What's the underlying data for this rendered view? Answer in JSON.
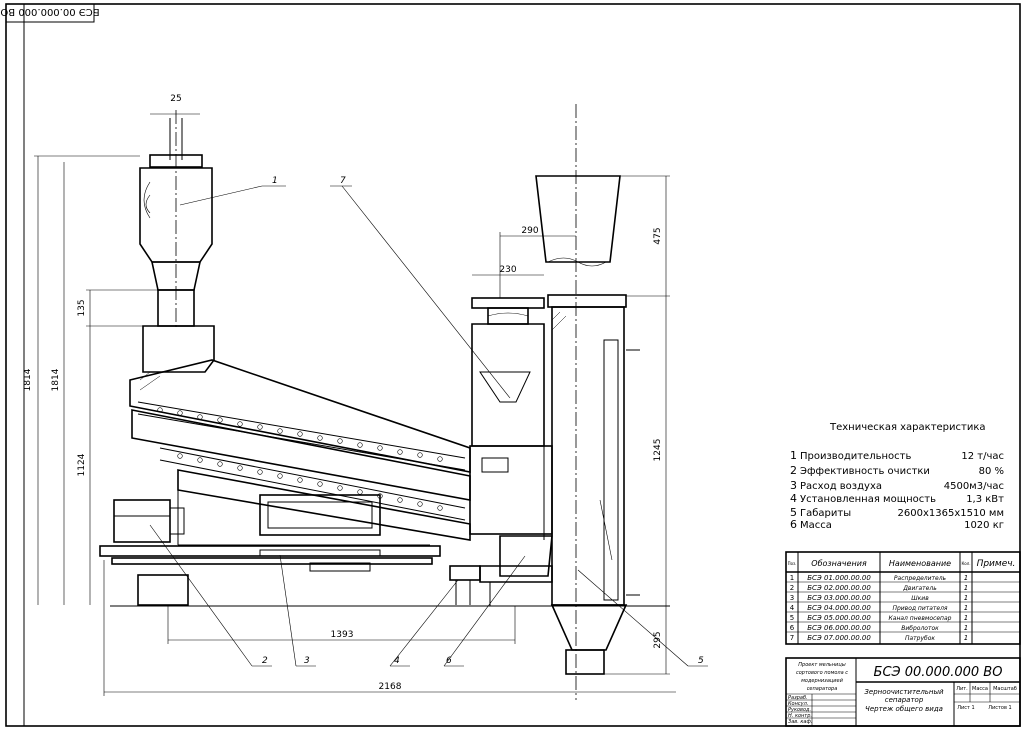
{
  "stamp_top": "БСЭ 00.000.000 ВО",
  "dimensions": {
    "d25": "25",
    "d135": "135",
    "d1814a": "1814",
    "d1814b": "1814",
    "d1124": "1124",
    "d290": "290",
    "d230": "230",
    "d475": "475",
    "d1245": "1245",
    "d295": "295",
    "d1393": "1393",
    "d2168": "2168"
  },
  "callouts": [
    "1",
    "2",
    "3",
    "4",
    "5",
    "6",
    "7"
  ],
  "specs": {
    "title": "Техническая характеристика",
    "rows": [
      {
        "n": "1",
        "label": "Производительность",
        "value": "12 т/час"
      },
      {
        "n": "2",
        "label": "Эффективность очистки",
        "value": "80 %"
      },
      {
        "n": "3",
        "label": "Расход воздуха",
        "value": "4500м3/час"
      },
      {
        "n": "4",
        "label": "Установленная мощность",
        "value": "1,3 кВт"
      },
      {
        "n": "5",
        "label": "Габариты",
        "value": "2600х1365х1510 мм"
      },
      {
        "n": "6",
        "label": "Масса",
        "value": "1020 кг"
      }
    ]
  },
  "parts_table": {
    "headers": {
      "pos": "Поз.",
      "code": "Обозначения",
      "name": "Наименование",
      "qty": "Кол.",
      "note": "Примеч."
    },
    "rows": [
      {
        "pos": "1",
        "code": "БСЭ 01.000.00.00",
        "name": "Распределитель",
        "qty": "1"
      },
      {
        "pos": "2",
        "code": "БСЭ 02.000.00.00",
        "name": "Двигатель",
        "qty": "1"
      },
      {
        "pos": "3",
        "code": "БСЭ 03.000.00.00",
        "name": "Шкив",
        "qty": "1"
      },
      {
        "pos": "4",
        "code": "БСЭ 04.000.00.00",
        "name": "Привод питателя",
        "qty": "1"
      },
      {
        "pos": "5",
        "code": "БСЭ 05.000.00.00",
        "name": "Канал пневмосепар",
        "qty": "1"
      },
      {
        "pos": "6",
        "code": "БСЭ 06.000.00.00",
        "name": "Вибролоток",
        "qty": "1"
      },
      {
        "pos": "7",
        "code": "БСЭ 07.000.00.00",
        "name": "Патрубок",
        "qty": "1"
      }
    ]
  },
  "title_block": {
    "project": [
      "Проект мельницы",
      "сортового помола с",
      "модернизацией",
      "сепаратора"
    ],
    "code": "БСЭ 00.000.000 ВО",
    "name": [
      "Зерноочистительный",
      "сепаратор",
      "Чертеж общего вида"
    ],
    "lit": "Лит.",
    "mass": "Масса",
    "scale": "Масштаб",
    "sheet": "Лист 1",
    "sheets": "Листов 1",
    "roles": [
      "Разраб.",
      "Консул.",
      "Руковод.",
      "Н. контр.",
      "Зав. каф."
    ]
  }
}
